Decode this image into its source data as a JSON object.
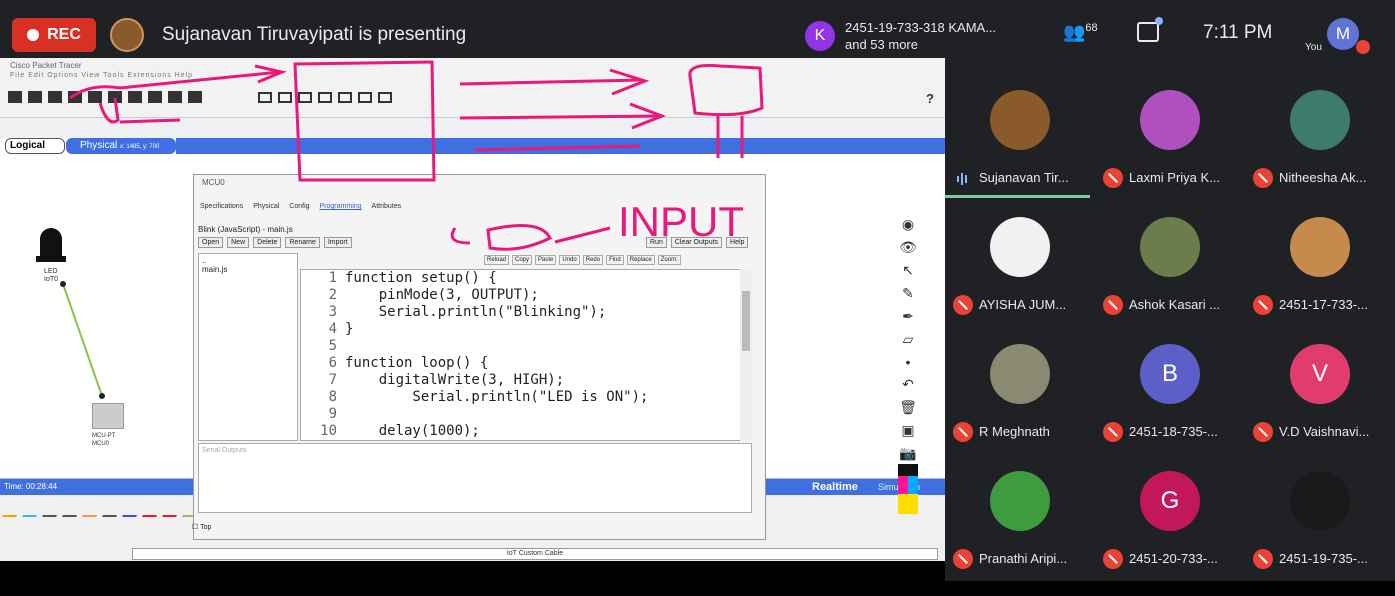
{
  "meeting": {
    "rec_label": "REC",
    "presenter_text": "Sujanavan Tiruvayipati is presenting",
    "join_name": "2451-19-733-318 KAMA...",
    "join_more": "and 53 more",
    "join_initial": "K",
    "participants_count": "68",
    "time": "7:11 PM",
    "you_label": "You",
    "you_initial": "M"
  },
  "packet_tracer": {
    "window_title": "Cisco Packet Tracer",
    "menu": "File  Edit  Options  View  Tools  Extensions  Help",
    "help_symbol": "?",
    "logical_tab": "Logical",
    "physical_tab": "Physical",
    "physical_coords": "x: 1485, y: 700",
    "led_label": "LED",
    "led_sublabel": "IoT0",
    "mcu_label": "MCU-PT",
    "mcu_sublabel": "MCU0",
    "status_time": "Time: 00:28:44",
    "realtime_label": "Realtime",
    "simulation_label": "Simulation",
    "iot_cable_label": "IoT Custom Cable",
    "dialog": {
      "title": "MCU0",
      "tabs": [
        "Specifications",
        "Physical",
        "Config",
        "Programming",
        "Attributes"
      ],
      "active_tab": "Programming",
      "file_title": "Blink (JavaScript) - main.js",
      "file_buttons": [
        "Open",
        "New",
        "Delete",
        "Rename",
        "Import"
      ],
      "run_buttons": [
        "Run",
        "Clear Outputs",
        "Help"
      ],
      "edit_buttons": [
        "Reload",
        "Copy",
        "Paste",
        "Undo",
        "Redo",
        "Find",
        "Replace",
        "Zoom:"
      ],
      "files": [
        "..",
        "main.js"
      ],
      "code_lines": [
        {
          "n": "1",
          "t": "function setup() {"
        },
        {
          "n": "2",
          "t": "    pinMode(3, OUTPUT);"
        },
        {
          "n": "3",
          "t": "    Serial.println(\"Blinking\");"
        },
        {
          "n": "4",
          "t": "}"
        },
        {
          "n": "5",
          "t": ""
        },
        {
          "n": "6",
          "t": "function loop() {"
        },
        {
          "n": "7",
          "t": "    digitalWrite(3, HIGH);"
        },
        {
          "n": "8",
          "t": "        Serial.println(\"LED is ON\");"
        },
        {
          "n": "9",
          "t": ""
        },
        {
          "n": "10",
          "t": "    delay(1000);"
        }
      ],
      "output_placeholder": "Serial Outputs",
      "top_checkbox": "Top"
    },
    "annotation_text": "INPUT"
  },
  "participants": [
    {
      "name": "Sujanavan Tir...",
      "initial": "",
      "color": "#8a5a2b",
      "muted": false,
      "speaking": true
    },
    {
      "name": "Laxmi Priya K...",
      "initial": "",
      "color": "#b04fc0",
      "muted": true
    },
    {
      "name": "Nitheesha Ak...",
      "initial": "",
      "color": "#3d7b6a",
      "muted": true
    },
    {
      "name": "AYISHA JUM...",
      "initial": "",
      "color": "#f1f1f1",
      "muted": true
    },
    {
      "name": "Ashok Kasari ...",
      "initial": "",
      "color": "#6b7d4a",
      "muted": true
    },
    {
      "name": "2451-17-733-...",
      "initial": "",
      "color": "#c58a4c",
      "muted": true
    },
    {
      "name": "R Meghnath",
      "initial": "",
      "color": "#8a8a73",
      "muted": true
    },
    {
      "name": "2451-18-735-...",
      "initial": "B",
      "color": "#5b5fc7",
      "muted": true
    },
    {
      "name": "V.D Vaishnavi...",
      "initial": "V",
      "color": "#e03c6f",
      "muted": true
    },
    {
      "name": "Pranathi Aripi...",
      "initial": "",
      "color": "#3e9b3e",
      "muted": true
    },
    {
      "name": "2451-20-733-...",
      "initial": "G",
      "color": "#c2185b",
      "muted": true
    },
    {
      "name": "2451-19-735-...",
      "initial": "",
      "color": "#1a1a1a",
      "muted": true
    }
  ]
}
